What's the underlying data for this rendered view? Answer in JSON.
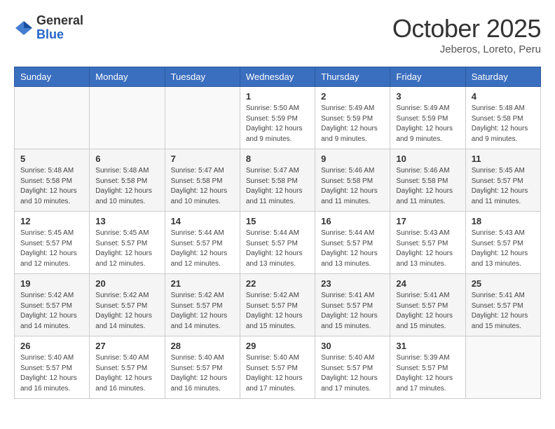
{
  "logo": {
    "general": "General",
    "blue": "Blue"
  },
  "header": {
    "month": "October 2025",
    "location": "Jeberos, Loreto, Peru"
  },
  "weekdays": [
    "Sunday",
    "Monday",
    "Tuesday",
    "Wednesday",
    "Thursday",
    "Friday",
    "Saturday"
  ],
  "weeks": [
    [
      {
        "day": "",
        "info": ""
      },
      {
        "day": "",
        "info": ""
      },
      {
        "day": "",
        "info": ""
      },
      {
        "day": "1",
        "info": "Sunrise: 5:50 AM\nSunset: 5:59 PM\nDaylight: 12 hours\nand 9 minutes."
      },
      {
        "day": "2",
        "info": "Sunrise: 5:49 AM\nSunset: 5:59 PM\nDaylight: 12 hours\nand 9 minutes."
      },
      {
        "day": "3",
        "info": "Sunrise: 5:49 AM\nSunset: 5:59 PM\nDaylight: 12 hours\nand 9 minutes."
      },
      {
        "day": "4",
        "info": "Sunrise: 5:48 AM\nSunset: 5:58 PM\nDaylight: 12 hours\nand 9 minutes."
      }
    ],
    [
      {
        "day": "5",
        "info": "Sunrise: 5:48 AM\nSunset: 5:58 PM\nDaylight: 12 hours\nand 10 minutes."
      },
      {
        "day": "6",
        "info": "Sunrise: 5:48 AM\nSunset: 5:58 PM\nDaylight: 12 hours\nand 10 minutes."
      },
      {
        "day": "7",
        "info": "Sunrise: 5:47 AM\nSunset: 5:58 PM\nDaylight: 12 hours\nand 10 minutes."
      },
      {
        "day": "8",
        "info": "Sunrise: 5:47 AM\nSunset: 5:58 PM\nDaylight: 12 hours\nand 11 minutes."
      },
      {
        "day": "9",
        "info": "Sunrise: 5:46 AM\nSunset: 5:58 PM\nDaylight: 12 hours\nand 11 minutes."
      },
      {
        "day": "10",
        "info": "Sunrise: 5:46 AM\nSunset: 5:58 PM\nDaylight: 12 hours\nand 11 minutes."
      },
      {
        "day": "11",
        "info": "Sunrise: 5:45 AM\nSunset: 5:57 PM\nDaylight: 12 hours\nand 11 minutes."
      }
    ],
    [
      {
        "day": "12",
        "info": "Sunrise: 5:45 AM\nSunset: 5:57 PM\nDaylight: 12 hours\nand 12 minutes."
      },
      {
        "day": "13",
        "info": "Sunrise: 5:45 AM\nSunset: 5:57 PM\nDaylight: 12 hours\nand 12 minutes."
      },
      {
        "day": "14",
        "info": "Sunrise: 5:44 AM\nSunset: 5:57 PM\nDaylight: 12 hours\nand 12 minutes."
      },
      {
        "day": "15",
        "info": "Sunrise: 5:44 AM\nSunset: 5:57 PM\nDaylight: 12 hours\nand 13 minutes."
      },
      {
        "day": "16",
        "info": "Sunrise: 5:44 AM\nSunset: 5:57 PM\nDaylight: 12 hours\nand 13 minutes."
      },
      {
        "day": "17",
        "info": "Sunrise: 5:43 AM\nSunset: 5:57 PM\nDaylight: 12 hours\nand 13 minutes."
      },
      {
        "day": "18",
        "info": "Sunrise: 5:43 AM\nSunset: 5:57 PM\nDaylight: 12 hours\nand 13 minutes."
      }
    ],
    [
      {
        "day": "19",
        "info": "Sunrise: 5:42 AM\nSunset: 5:57 PM\nDaylight: 12 hours\nand 14 minutes."
      },
      {
        "day": "20",
        "info": "Sunrise: 5:42 AM\nSunset: 5:57 PM\nDaylight: 12 hours\nand 14 minutes."
      },
      {
        "day": "21",
        "info": "Sunrise: 5:42 AM\nSunset: 5:57 PM\nDaylight: 12 hours\nand 14 minutes."
      },
      {
        "day": "22",
        "info": "Sunrise: 5:42 AM\nSunset: 5:57 PM\nDaylight: 12 hours\nand 15 minutes."
      },
      {
        "day": "23",
        "info": "Sunrise: 5:41 AM\nSunset: 5:57 PM\nDaylight: 12 hours\nand 15 minutes."
      },
      {
        "day": "24",
        "info": "Sunrise: 5:41 AM\nSunset: 5:57 PM\nDaylight: 12 hours\nand 15 minutes."
      },
      {
        "day": "25",
        "info": "Sunrise: 5:41 AM\nSunset: 5:57 PM\nDaylight: 12 hours\nand 15 minutes."
      }
    ],
    [
      {
        "day": "26",
        "info": "Sunrise: 5:40 AM\nSunset: 5:57 PM\nDaylight: 12 hours\nand 16 minutes."
      },
      {
        "day": "27",
        "info": "Sunrise: 5:40 AM\nSunset: 5:57 PM\nDaylight: 12 hours\nand 16 minutes."
      },
      {
        "day": "28",
        "info": "Sunrise: 5:40 AM\nSunset: 5:57 PM\nDaylight: 12 hours\nand 16 minutes."
      },
      {
        "day": "29",
        "info": "Sunrise: 5:40 AM\nSunset: 5:57 PM\nDaylight: 12 hours\nand 17 minutes."
      },
      {
        "day": "30",
        "info": "Sunrise: 5:40 AM\nSunset: 5:57 PM\nDaylight: 12 hours\nand 17 minutes."
      },
      {
        "day": "31",
        "info": "Sunrise: 5:39 AM\nSunset: 5:57 PM\nDaylight: 12 hours\nand 17 minutes."
      },
      {
        "day": "",
        "info": ""
      }
    ]
  ]
}
